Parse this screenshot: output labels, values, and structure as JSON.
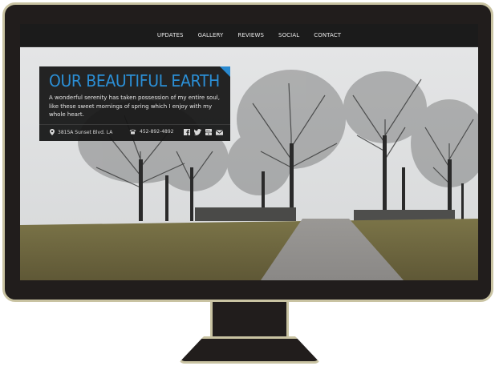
{
  "nav": {
    "items": [
      "UPDATES",
      "GALLERY",
      "REVIEWS",
      "SOCIAL",
      "CONTACT"
    ]
  },
  "hero": {
    "title": "OUR BEAUTIFUL EARTH",
    "description": "A wonderful serenity has taken possession of my entire soul, like these sweet mornings of spring which I enjoy with my whole heart.",
    "address": "3815A Sunset Blvd. LA",
    "phone": "452-892-4892"
  },
  "social": {
    "icons": [
      "facebook-icon",
      "twitter-icon",
      "youtube-icon",
      "mail-icon"
    ]
  },
  "colors": {
    "accent": "#2b8fd6",
    "bezel": "#211d1c",
    "frame": "#c9c3a2",
    "nav_bg": "#1b1b1b"
  }
}
